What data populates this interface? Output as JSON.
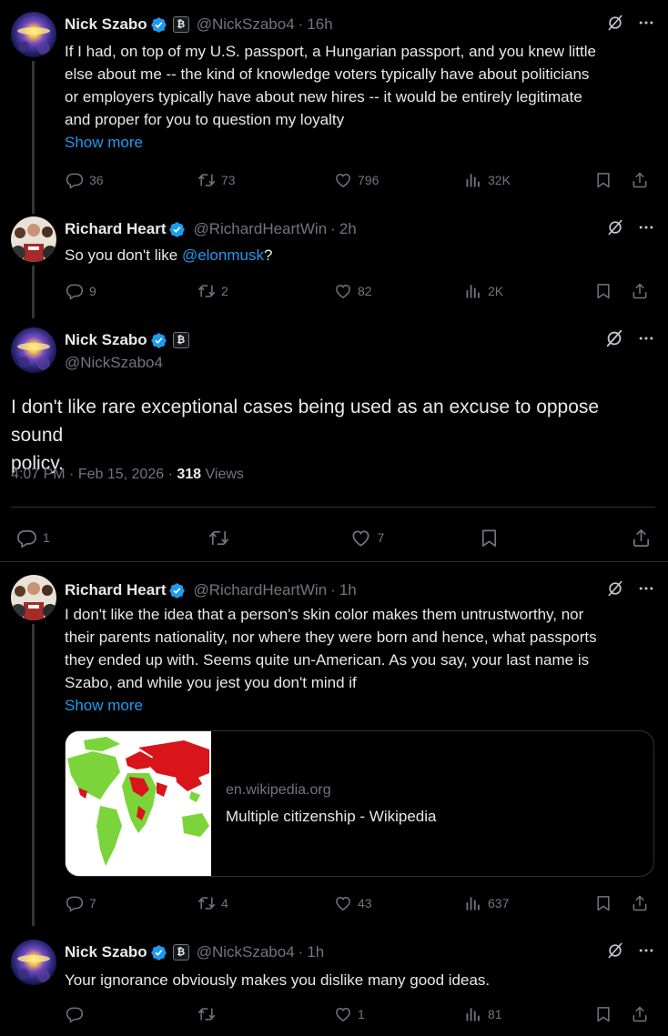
{
  "tweets": [
    {
      "name": "Nick Szabo",
      "affiliate_badge": "₿",
      "handle": "@NickSzabo4",
      "time": "16h",
      "text_lines": [
        "If I had, on top of my U.S. passport, a  Hungarian passport, and you knew little",
        "else about me -- the kind of knowledge voters typically have about politicians",
        "or employers typically have about new hires -- it would be entirely legitimate",
        "and proper for you to question my loyalty"
      ],
      "show_more": "Show more",
      "stats": {
        "replies": "36",
        "reposts": "73",
        "likes": "796",
        "views": "32K"
      }
    },
    {
      "name": "Richard Heart",
      "handle": "@RichardHeartWin",
      "time": "2h",
      "text_before": "So you don't like ",
      "mention": "@elonmusk",
      "text_after": "?",
      "stats": {
        "replies": "9",
        "reposts": "2",
        "likes": "82",
        "views": "2K"
      }
    },
    {
      "name": "Nick Szabo",
      "affiliate_badge": "₿",
      "handle": "@NickSzabo4",
      "text_lines": [
        "I don't like rare exceptional cases being used as an excuse to oppose sound",
        "policy."
      ],
      "meta_time": "4:07 PM",
      "meta_date": "Feb 15, 2026",
      "views_count": "318",
      "views_label": "Views",
      "stats": {
        "replies": "1",
        "likes": "7"
      }
    },
    {
      "name": "Richard Heart",
      "handle": "@RichardHeartWin",
      "time": "1h",
      "text_lines": [
        "I don't like the idea that a person's skin color makes them untrustworthy, nor",
        "their parents nationality, nor where they were born and hence, what passports",
        "they ended up with. Seems quite un-American. As you say, your last name is",
        "Szabo, and while you jest you don't mind if"
      ],
      "show_more": "Show more",
      "card": {
        "domain": "en.wikipedia.org",
        "title": "Multiple citizenship - Wikipedia"
      },
      "stats": {
        "replies": "7",
        "reposts": "4",
        "likes": "43",
        "views": "637"
      }
    },
    {
      "name": "Nick Szabo",
      "affiliate_badge": "₿",
      "handle": "@NickSzabo4",
      "time": "1h",
      "text_lines": [
        "Your ignorance obviously makes you dislike many good ideas."
      ],
      "stats": {
        "likes": "1",
        "views": "81"
      }
    }
  ],
  "sep": "·",
  "icons": {
    "verified": "verified-badge-icon",
    "grok": "grok-icon",
    "more": "more-icon",
    "reply": "reply-icon",
    "repost": "repost-icon",
    "like": "like-icon",
    "views": "views-icon",
    "bookmark": "bookmark-icon",
    "share": "share-icon"
  },
  "colors": {
    "accent": "#1d9bf0",
    "muted": "#71767b",
    "text": "#e7e9ea",
    "background": "#000000"
  }
}
